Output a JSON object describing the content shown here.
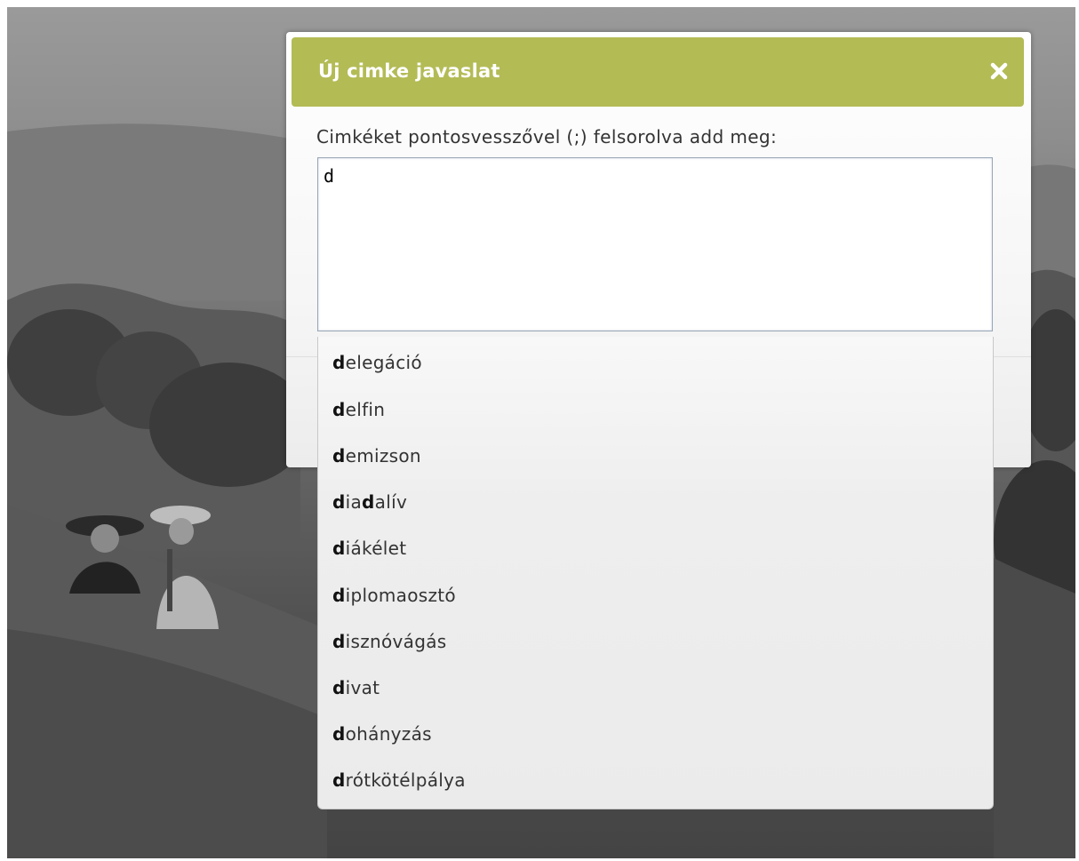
{
  "dialog": {
    "title": "Új cimke javaslat",
    "close_icon": "close-icon",
    "label": "Cimkéket pontosvesszővel (;) felsorolva add meg:",
    "textarea_value": "d"
  },
  "autocomplete": {
    "items": [
      {
        "bold": "d",
        "rest": "elegáció"
      },
      {
        "bold": "d",
        "rest": "elfin"
      },
      {
        "bold": "d",
        "rest": "emizson"
      },
      {
        "bold": "d",
        "rest": "ia",
        "bold2": "d",
        "rest2": "alív"
      },
      {
        "bold": "d",
        "rest": "iákélet"
      },
      {
        "bold": "d",
        "rest": "iplomaosztó"
      },
      {
        "bold": "d",
        "rest": "isznóvágás"
      },
      {
        "bold": "d",
        "rest": "ivat"
      },
      {
        "bold": "d",
        "rest": "ohányzás"
      },
      {
        "bold": "d",
        "rest": "rótkötélpálya"
      }
    ]
  },
  "colors": {
    "header_bg": "#b3bb55",
    "header_text": "#ffffff"
  }
}
